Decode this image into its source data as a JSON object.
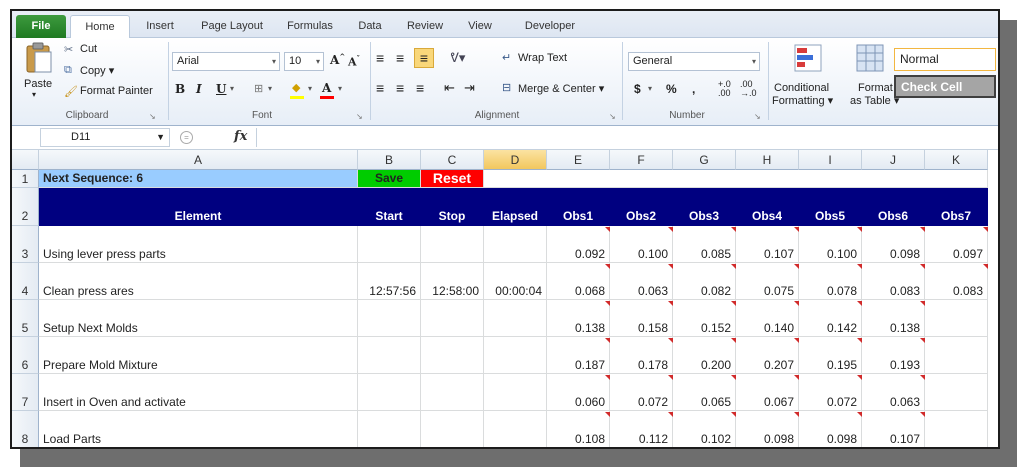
{
  "ribbon": {
    "tabs": [
      "File",
      "Home",
      "Insert",
      "Page Layout",
      "Formulas",
      "Data",
      "Review",
      "View",
      "Developer"
    ],
    "clipboard": {
      "paste": "Paste",
      "cut": "Cut",
      "copy": "Copy ▾",
      "format_painter": "Format Painter",
      "label": "Clipboard"
    },
    "font": {
      "name": "Arial",
      "size": "10",
      "label": "Font"
    },
    "alignment": {
      "wrap_text": "Wrap Text",
      "merge_center": "Merge & Center ▾",
      "label": "Alignment"
    },
    "number": {
      "format": "General",
      "label": "Number"
    },
    "styles": {
      "conditional_line1": "Conditional",
      "conditional_line2": "Formatting ▾",
      "format_table_line1": "Format",
      "format_table_line2": "as Table ▾",
      "normal": "Normal",
      "check_cell": "Check Cell"
    }
  },
  "formula_bar": {
    "name_box": "D11",
    "fx": "fx"
  },
  "columns": [
    "A",
    "B",
    "C",
    "D",
    "E",
    "F",
    "G",
    "H",
    "I",
    "J",
    "K"
  ],
  "rows": [
    "1",
    "2",
    "3",
    "4",
    "5",
    "6",
    "7",
    "8"
  ],
  "sheet": {
    "next_sequence": "Next Sequence: 6",
    "save": "Save",
    "reset": "Reset",
    "headers": [
      "Element",
      "Start",
      "Stop",
      "Elapsed",
      "Obs1",
      "Obs2",
      "Obs3",
      "Obs4",
      "Obs5",
      "Obs6",
      "Obs7"
    ],
    "data_rows": [
      {
        "element": "Using lever press parts",
        "start": "",
        "stop": "",
        "elapsed": "",
        "obs": [
          "0.092",
          "0.100",
          "0.085",
          "0.107",
          "0.100",
          "0.098",
          "0.097"
        ]
      },
      {
        "element": "Clean press ares",
        "start": "12:57:56",
        "stop": "12:58:00",
        "elapsed": "00:00:04",
        "obs": [
          "0.068",
          "0.063",
          "0.082",
          "0.075",
          "0.078",
          "0.083",
          "0.083"
        ]
      },
      {
        "element": "Setup Next Molds",
        "start": "",
        "stop": "",
        "elapsed": "",
        "obs": [
          "0.138",
          "0.158",
          "0.152",
          "0.140",
          "0.142",
          "0.138",
          ""
        ]
      },
      {
        "element": "Prepare Mold Mixture",
        "start": "",
        "stop": "",
        "elapsed": "",
        "obs": [
          "0.187",
          "0.178",
          "0.200",
          "0.207",
          "0.195",
          "0.193",
          ""
        ]
      },
      {
        "element": "Insert in Oven and activate",
        "start": "",
        "stop": "",
        "elapsed": "",
        "obs": [
          "0.060",
          "0.072",
          "0.065",
          "0.067",
          "0.072",
          "0.063",
          ""
        ]
      },
      {
        "element": "Load Parts",
        "start": "",
        "stop": "",
        "elapsed": "",
        "obs": [
          "0.108",
          "0.112",
          "0.102",
          "0.098",
          "0.098",
          "0.107",
          ""
        ]
      }
    ]
  },
  "colors": {
    "header_band": "#000080",
    "sequence_fill": "#99ccff",
    "save_fill": "#00cc00",
    "reset_fill": "#ff0000",
    "selected_col": "#f2c75e",
    "file_tab": "#1f7a22"
  }
}
